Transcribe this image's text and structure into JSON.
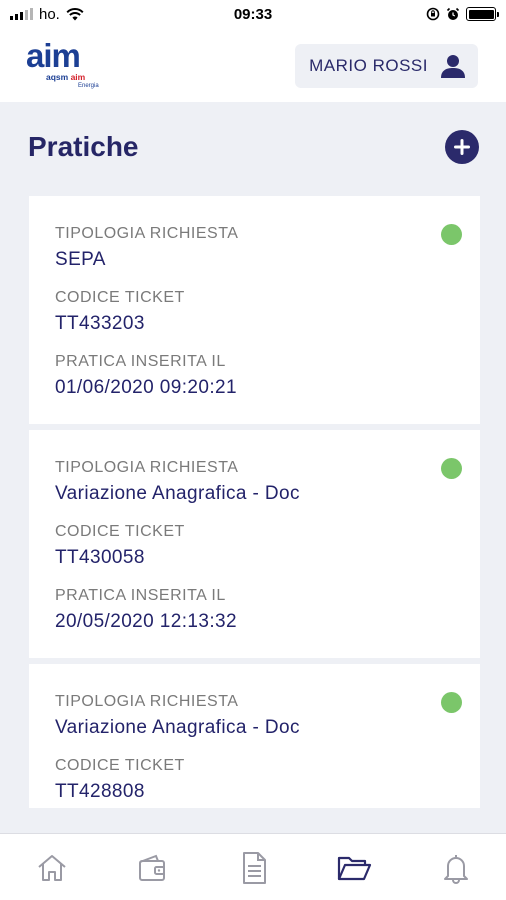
{
  "status_bar": {
    "carrier": "ho.",
    "time": "09:33"
  },
  "header": {
    "logo": {
      "main": "aim",
      "sub_left": "aqsm ",
      "sub_right": "aim",
      "tagline": "Energia"
    },
    "user_name": "MARIO ROSSI"
  },
  "page": {
    "title": "Pratiche"
  },
  "tickets": [
    {
      "type_label": "TIPOLOGIA RICHIESTA",
      "type_value": "SEPA",
      "code_label": "CODICE TICKET",
      "code_value": "TT433203",
      "date_label": "PRATICA INSERITA IL",
      "date_value": "01/06/2020 09:20:21",
      "status_color": "#7bc66a"
    },
    {
      "type_label": "TIPOLOGIA RICHIESTA",
      "type_value": "Variazione Anagrafica - Doc",
      "code_label": "CODICE TICKET",
      "code_value": "TT430058",
      "date_label": "PRATICA INSERITA IL",
      "date_value": "20/05/2020 12:13:32",
      "status_color": "#7bc66a"
    },
    {
      "type_label": "TIPOLOGIA RICHIESTA",
      "type_value": "Variazione Anagrafica - Doc",
      "code_label": "CODICE TICKET",
      "code_value": "TT428808",
      "status_color": "#7bc66a"
    }
  ],
  "tabbar": {
    "items": [
      {
        "icon": "home-icon",
        "active": false
      },
      {
        "icon": "wallet-icon",
        "active": false
      },
      {
        "icon": "document-icon",
        "active": false
      },
      {
        "icon": "folder-open-icon",
        "active": true
      },
      {
        "icon": "bell-icon",
        "active": false
      }
    ],
    "active_color": "#2b2a6b",
    "inactive_color": "#9a9aa4"
  },
  "colors": {
    "brand": "#1c3f94",
    "accent": "#2b2a6b",
    "status_ok": "#7bc66a",
    "background": "#eef0f5"
  }
}
